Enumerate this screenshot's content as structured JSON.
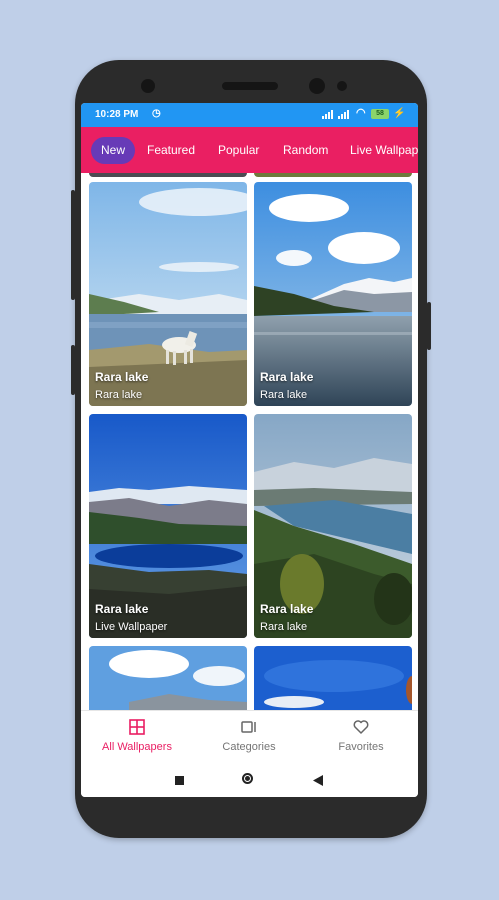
{
  "status_bar": {
    "time": "10:28 PM",
    "battery": "58",
    "icons": [
      "clock-icon",
      "signal-icon",
      "wifi-icon",
      "battery-icon",
      "charging-icon"
    ]
  },
  "tabs": [
    {
      "label": "New",
      "active": true
    },
    {
      "label": "Featured",
      "active": false
    },
    {
      "label": "Popular",
      "active": false
    },
    {
      "label": "Random",
      "active": false
    },
    {
      "label": "Live Wallpaper",
      "active": false
    }
  ],
  "wallpapers": [
    {
      "title": "Rara lake",
      "subtitle": "Rara lake"
    },
    {
      "title": "Rara lake",
      "subtitle": "Rara lake"
    },
    {
      "title": "Rara lake",
      "subtitle": "Live Wallpaper"
    },
    {
      "title": "Rara lake",
      "subtitle": "Rara lake"
    }
  ],
  "bottom_nav": [
    {
      "label": "All Wallpapers",
      "icon": "grid-icon",
      "active": true
    },
    {
      "label": "Categories",
      "icon": "categories-icon",
      "active": false
    },
    {
      "label": "Favorites",
      "icon": "heart-icon",
      "active": false
    }
  ],
  "colors": {
    "status_bar": "#2196f3",
    "tab_bar": "#ea1f62",
    "active_tab": "#673ab7",
    "active_nav": "#e91e63"
  }
}
